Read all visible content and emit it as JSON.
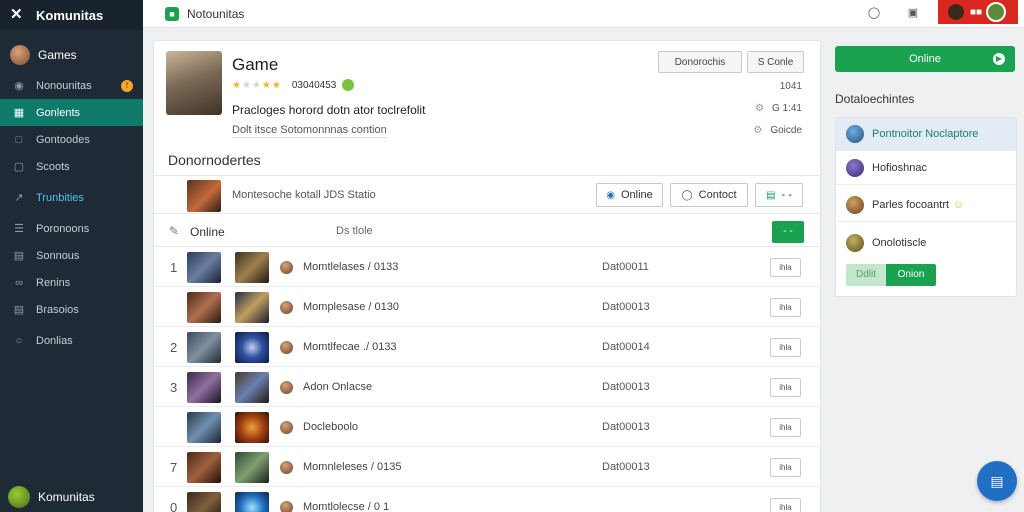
{
  "app": {
    "brand": "Komunitas",
    "footer_user": "Komunitas"
  },
  "topbar": {
    "tab_label": "Notounitas"
  },
  "sidebar": {
    "user": "Games",
    "items": [
      {
        "label": "Nonounitas",
        "badge": "!"
      },
      {
        "label": "Gonlents",
        "active": true
      },
      {
        "label": "Gontoodes"
      },
      {
        "label": "Scoots"
      },
      {
        "label": "Trunbities",
        "accent": true
      },
      {
        "label": "Poronoons"
      },
      {
        "label": "Sonnous"
      },
      {
        "label": "Renins"
      },
      {
        "label": "Brasoios"
      },
      {
        "label": "Donlias"
      }
    ]
  },
  "game": {
    "title": "Game",
    "rating_text": "03040453",
    "description": "Pracloges horord dotn ator toclrefolit",
    "subdescription": "Dolt itsce Sotomonnnas contion",
    "buttons": {
      "primary": "Donorochis",
      "secondary": "S Conle"
    },
    "meta": {
      "count": "1041",
      "views": "G 1:41",
      "other": "Goicde"
    }
  },
  "section": {
    "title": "Donornodertes"
  },
  "filter": {
    "text": "Montesoche kotall JDS Statio",
    "online_label": "Online",
    "contact_label": "Contoct",
    "extra_label": "- -"
  },
  "list": {
    "header": {
      "online": "Online",
      "status": "Ds tlole",
      "add_label": "- -"
    },
    "rows": [
      {
        "num": "1",
        "name": "Momtlelases / 0133",
        "date": "Dat00011"
      },
      {
        "num": "",
        "name": "Momplesase / 0130",
        "date": "Dat00013"
      },
      {
        "num": "2",
        "name": "Momtlfecae ./ 0133",
        "date": "Dat00014"
      },
      {
        "num": "3",
        "name": "Adon Onlacse",
        "date": "Dat00013"
      },
      {
        "num": "",
        "name": "Docleboolo",
        "date": "Dat00013"
      },
      {
        "num": "7",
        "name": "Momnleleses / 0135",
        "date": "Dat00013"
      },
      {
        "num": "0",
        "name": "Momtlolecse / 0 1",
        "date": ""
      }
    ],
    "action_label": "ihla"
  },
  "right_panel": {
    "status_button": "Online",
    "title": "Dotaloechintes",
    "items": [
      {
        "label": "Pontnoitor Noclaptore",
        "selected": true
      },
      {
        "label": "Hofioshnac"
      },
      {
        "label": "Parles focoantrt"
      },
      {
        "label": "Onolotiscle"
      }
    ],
    "toggle_off": "Ddlit",
    "toggle_on": "Onion"
  },
  "colors": {
    "primary_green": "#1aa251",
    "sidebar_bg": "#1e2a36",
    "active_teal": "#0f7a6b",
    "alert_red": "#d9281f",
    "fab_blue": "#1f6fc4"
  }
}
